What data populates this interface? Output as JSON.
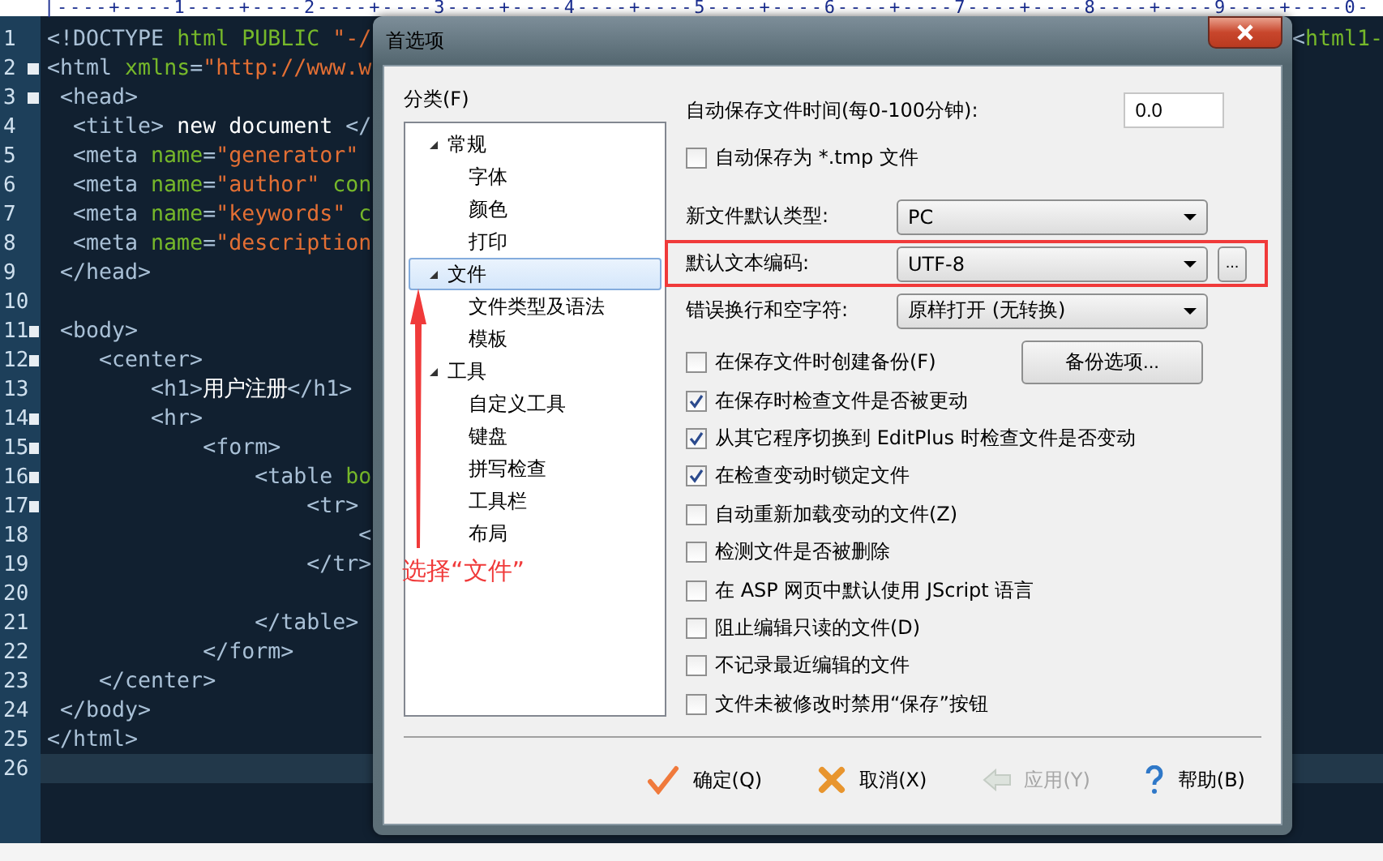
{
  "editor": {
    "ruler": "|----+----1----+----2----+----3----+----4----+----5----+----6----+----7----+----8----+----9----+----0-",
    "lines": [
      {
        "number": "1",
        "fold": false,
        "current": false,
        "tokens": [
          {
            "kind": "tag",
            "text": "<!DOCTYPE "
          },
          {
            "kind": "attr",
            "text": "html PUBLIC "
          },
          {
            "kind": "string",
            "text": "\"-/"
          }
        ],
        "tail": [
          {
            "kind": "tag",
            "text": "<"
          },
          {
            "kind": "attr",
            "text": "html1-"
          }
        ]
      },
      {
        "number": "2",
        "fold": true,
        "current": false,
        "tokens": [
          {
            "kind": "tag",
            "text": "<html "
          },
          {
            "kind": "attr",
            "text": "xmlns"
          },
          {
            "kind": "tag",
            "text": "="
          },
          {
            "kind": "string",
            "text": "\"http://www.w"
          }
        ]
      },
      {
        "number": "3",
        "fold": true,
        "current": false,
        "tokens": [
          {
            "kind": "tag",
            "text": " <head>"
          }
        ]
      },
      {
        "number": "4",
        "fold": false,
        "current": false,
        "tokens": [
          {
            "kind": "tag",
            "text": "  <title> "
          },
          {
            "kind": "text",
            "text": "new document "
          },
          {
            "kind": "tag",
            "text": "</"
          }
        ]
      },
      {
        "number": "5",
        "fold": false,
        "current": false,
        "tokens": [
          {
            "kind": "tag",
            "text": "  <meta "
          },
          {
            "kind": "attr",
            "text": "name"
          },
          {
            "kind": "tag",
            "text": "="
          },
          {
            "kind": "string",
            "text": "\"generator\""
          }
        ]
      },
      {
        "number": "6",
        "fold": false,
        "current": false,
        "tokens": [
          {
            "kind": "tag",
            "text": "  <meta "
          },
          {
            "kind": "attr",
            "text": "name"
          },
          {
            "kind": "tag",
            "text": "="
          },
          {
            "kind": "string",
            "text": "\"author\" "
          },
          {
            "kind": "attr",
            "text": "con"
          }
        ]
      },
      {
        "number": "7",
        "fold": false,
        "current": false,
        "tokens": [
          {
            "kind": "tag",
            "text": "  <meta "
          },
          {
            "kind": "attr",
            "text": "name"
          },
          {
            "kind": "tag",
            "text": "="
          },
          {
            "kind": "string",
            "text": "\"keywords\" "
          },
          {
            "kind": "attr",
            "text": "c"
          }
        ]
      },
      {
        "number": "8",
        "fold": false,
        "current": false,
        "tokens": [
          {
            "kind": "tag",
            "text": "  <meta "
          },
          {
            "kind": "attr",
            "text": "name"
          },
          {
            "kind": "tag",
            "text": "="
          },
          {
            "kind": "string",
            "text": "\"description"
          }
        ]
      },
      {
        "number": "9",
        "fold": false,
        "current": false,
        "tokens": [
          {
            "kind": "tag",
            "text": " </head>"
          }
        ]
      },
      {
        "number": "10",
        "fold": false,
        "current": false
      },
      {
        "number": "11",
        "fold": true,
        "current": false,
        "tokens": [
          {
            "kind": "tag",
            "text": " <body>"
          }
        ]
      },
      {
        "number": "12",
        "fold": true,
        "current": false,
        "tokens": [
          {
            "kind": "tag",
            "text": "    <center>"
          }
        ]
      },
      {
        "number": "13",
        "fold": false,
        "current": false,
        "tokens": [
          {
            "kind": "tag",
            "text": "        <h1>"
          },
          {
            "kind": "text",
            "text": "用户注册"
          },
          {
            "kind": "tag",
            "text": "</h1>"
          }
        ]
      },
      {
        "number": "14",
        "fold": true,
        "current": false,
        "tokens": [
          {
            "kind": "tag",
            "text": "        <hr>"
          }
        ]
      },
      {
        "number": "15",
        "fold": true,
        "current": false,
        "tokens": [
          {
            "kind": "tag",
            "text": "            <form>"
          }
        ]
      },
      {
        "number": "16",
        "fold": true,
        "current": false,
        "tokens": [
          {
            "kind": "tag",
            "text": "                <table "
          },
          {
            "kind": "attr",
            "text": "bo"
          }
        ]
      },
      {
        "number": "17",
        "fold": true,
        "current": false,
        "tokens": [
          {
            "kind": "tag",
            "text": "                    <tr>"
          }
        ]
      },
      {
        "number": "18",
        "fold": false,
        "current": false,
        "tokens": [
          {
            "kind": "tag",
            "text": "                        <"
          }
        ]
      },
      {
        "number": "19",
        "fold": false,
        "current": false,
        "tokens": [
          {
            "kind": "tag",
            "text": "                    </tr>"
          }
        ]
      },
      {
        "number": "20",
        "fold": false,
        "current": false
      },
      {
        "number": "21",
        "fold": false,
        "current": false,
        "tokens": [
          {
            "kind": "tag",
            "text": "                </table>"
          }
        ]
      },
      {
        "number": "22",
        "fold": false,
        "current": false,
        "tokens": [
          {
            "kind": "tag",
            "text": "            </form>"
          }
        ]
      },
      {
        "number": "23",
        "fold": false,
        "current": false,
        "tokens": [
          {
            "kind": "tag",
            "text": "    </center>"
          }
        ]
      },
      {
        "number": "24",
        "fold": false,
        "current": false,
        "tokens": [
          {
            "kind": "tag",
            "text": " </body>"
          }
        ]
      },
      {
        "number": "25",
        "fold": false,
        "current": false,
        "tokens": [
          {
            "kind": "tag",
            "text": "</html>"
          }
        ]
      },
      {
        "number": "26",
        "fold": false,
        "current": true
      }
    ]
  },
  "dialog": {
    "title": "首选项",
    "category_label": "分类(F)",
    "tree": [
      {
        "label": "常规",
        "expanded": true,
        "selected": false,
        "children": [
          {
            "label": "字体",
            "selected": false
          },
          {
            "label": "颜色",
            "selected": false
          },
          {
            "label": "打印",
            "selected": false
          }
        ]
      },
      {
        "label": "文件",
        "expanded": true,
        "selected": true,
        "children": [
          {
            "label": "文件类型及语法",
            "selected": false
          },
          {
            "label": "模板",
            "selected": false
          }
        ]
      },
      {
        "label": "工具",
        "expanded": true,
        "selected": false,
        "children": [
          {
            "label": "自定义工具",
            "selected": false
          },
          {
            "label": "键盘",
            "selected": false
          },
          {
            "label": "拼写检查",
            "selected": false
          },
          {
            "label": "工具栏",
            "selected": false
          },
          {
            "label": "布局",
            "selected": false
          }
        ]
      }
    ],
    "settings": [
      {
        "kind": "input",
        "label": "自动保存文件时间(每0-100分钟):",
        "value": "0.0"
      },
      {
        "kind": "checkbox",
        "label": "自动保存为 *.tmp 文件",
        "checked": false
      },
      {
        "kind": "select",
        "label": "新文件默认类型:",
        "value": "PC",
        "highlighted": false
      },
      {
        "kind": "select",
        "label": "默认文本编码:",
        "value": "UTF-8",
        "highlighted": true,
        "extra_button": "..."
      },
      {
        "kind": "select",
        "label": "错误换行和空字符:",
        "value": "原样打开 (无转换)",
        "highlighted": false
      }
    ],
    "backup_button": "备份选项...",
    "checks": [
      {
        "label": "在保存文件时创建备份(F)",
        "checked": false
      },
      {
        "label": "在保存时检查文件是否被更动",
        "checked": true
      },
      {
        "label": "从其它程序切换到 EditPlus 时检查文件是否变动",
        "checked": true
      },
      {
        "label": "在检查变动时锁定文件",
        "checked": true
      },
      {
        "label": "自动重新加载变动的文件(Z)",
        "checked": false
      },
      {
        "label": "检测文件是否被删除",
        "checked": false
      },
      {
        "label": "在 ASP 网页中默认使用 JScript 语言",
        "checked": false
      },
      {
        "label": "阻止编辑只读的文件(D)",
        "checked": false
      },
      {
        "label": "不记录最近编辑的文件",
        "checked": false
      },
      {
        "label": "文件未被修改时禁用“保存”按钮",
        "checked": false
      }
    ],
    "buttons": [
      {
        "kind": "ok",
        "label": "确定(Q)",
        "disabled": false
      },
      {
        "kind": "cancel",
        "label": "取消(X)",
        "disabled": false
      },
      {
        "kind": "apply",
        "label": "应用(Y)",
        "disabled": true
      },
      {
        "kind": "help",
        "label": "帮助(B)",
        "disabled": false
      }
    ]
  },
  "annotation": {
    "text": "选择“文件”"
  }
}
